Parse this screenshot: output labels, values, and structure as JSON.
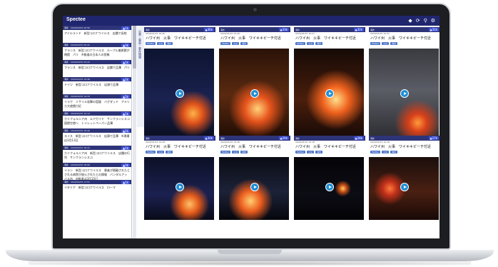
{
  "app": {
    "logo": "Spectee"
  },
  "colors": {
    "topbar": "#20266e",
    "accent": "#3c4fd8",
    "play": "#1f8fd6",
    "chip": "#4a73c8"
  },
  "toolbar": {
    "icons": [
      "bell-icon",
      "refresh-icon",
      "search-icon",
      "settings-icon"
    ]
  },
  "vertical_label": "災害・事故・事件情報",
  "sidebar": {
    "items": [
      {
        "tag": "海外",
        "time": "2020/03/15 20:56",
        "count": "▲1k",
        "text": "アイルランド　新型コロナウイルス　店舗で長蛇"
      },
      {
        "tag": "海外",
        "time": "2020/03/15 20:41",
        "count": "▲3k",
        "text": "フランス　新型コロナウイルス　ルーブル美術館が閉館　パリ　※報道の日本人の投稿"
      },
      {
        "tag": "海外",
        "time": "2020/03/15 20:22",
        "count": "▲1k",
        "text": "フランス　新型コロナウイルス　店舗で品薄　パリ"
      },
      {
        "tag": "海外",
        "time": "2020/03/15 19:48",
        "count": "▲2k",
        "text": "ドイツ　新型コロナウイルス　店頭で品薄"
      },
      {
        "tag": "海外",
        "time": "2020/03/15 19:33",
        "count": "▲5k",
        "text": "イラク　ミサイル攻撃の容疑　バグダッド　アメリカ大使館付近"
      },
      {
        "tag": "海外",
        "time": "2020/03/15 19:14",
        "count": "▲1k",
        "text": "カリフォルニア州　エアガイド　サンフランシスコ国際空港へ　トイレットペーパー品薄"
      },
      {
        "tag": "海外",
        "time": "2020/03/15 18:40",
        "count": "▲2k",
        "text": "スイス　新型コロナウイルス　店頭で品薄　※現場は3月13日"
      },
      {
        "tag": "海外",
        "time": "2020/03/15 18:22",
        "count": "▲1k",
        "text": "カリフォルニア州　新型コロナウイルス　店舗の行列　サンフランシスコ"
      },
      {
        "tag": "海外",
        "time": "2020/03/15 18:06",
        "count": "▲3k",
        "text": "イラン　新型コロナウイルス　患者が隔離されたとされる病院が放火されたとの情報　バンダルアッバス市　※報道は3月15日"
      },
      {
        "tag": "海外",
        "time": "2020/03/15 17:51",
        "count": "▲1k",
        "text": "イタリア　新型コロナウイルス　ローマ"
      }
    ]
  },
  "cards": [
    {
      "tag": "海外",
      "time": "2020/03/15 19:26",
      "count": "▲36k",
      "title": "ハワイ州　火事　ワイキキビーチ付近",
      "chips": [
        "Twitter",
        "火災",
        "海外"
      ]
    },
    {
      "tag": "海外",
      "time": "2020/03/15 19:26",
      "count": "▲33k",
      "title": "ハワイ州　火事　ワイキキビーチ付近",
      "chips": [
        "Twitter",
        "火災",
        "海外"
      ]
    },
    {
      "tag": "海外",
      "time": "2020/03/15 19:27",
      "count": "▲32k",
      "title": "ハワイ州　火事　ワイキキビーチ付近",
      "chips": [
        "Twitter",
        "火災",
        "海外"
      ]
    },
    {
      "tag": "海外",
      "time": "2020/03/15 19:31",
      "count": "▲31k",
      "title": "ハワイ州　火事　ワイキキビーチ付近",
      "chips": [
        "Twitter",
        "火災",
        "海外"
      ]
    },
    {
      "tag": "海外",
      "time": "2020/03/15 19:28",
      "count": "▲30k",
      "title": "ハワイ州　火事　ワイキキビーチ付近",
      "chips": [
        "Twitter",
        "火災",
        "海外"
      ]
    },
    {
      "tag": "海外",
      "time": "2020/03/15 19:28",
      "count": "▲29k",
      "title": "ハワイ州　火事　ワイキキビーチ付近",
      "chips": [
        "Twitter",
        "火災",
        "海外"
      ]
    },
    {
      "tag": "海外",
      "time": "2020/03/15 19:18",
      "count": "▲28k",
      "title": "ハワイ州　火事　ワイキキビーチ付近",
      "chips": [
        "Twitter",
        "火災",
        "海外"
      ]
    },
    {
      "tag": "海外",
      "time": "2020/03/15 19:18",
      "count": "▲27k",
      "title": "ハワイ州　火事　ワイキキビーチ付近",
      "chips": [
        "Twitter",
        "火災",
        "海外"
      ]
    }
  ]
}
